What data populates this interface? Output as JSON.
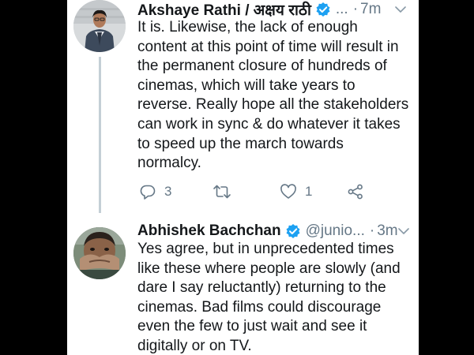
{
  "tweets": [
    {
      "author": {
        "name": "Akshaye Rathi / अक्षय राठी",
        "handle": "",
        "verified": true
      },
      "truncation": "...",
      "separator": "·",
      "time": "7m",
      "text_lines": [
        "It is. Likewise, the lack of enough",
        "content at this point of time will result in",
        "the permanent closure of hundreds of",
        "cinemas, which will take years to",
        "reverse. Really hope all the stakeholders",
        "can work in sync & do whatever it takes",
        "to speed up the march towards",
        "normalcy."
      ],
      "actions": {
        "replies": "3",
        "retweets": "",
        "likes": "1"
      }
    },
    {
      "author": {
        "name": "Abhishek Bachchan",
        "handle": "@junio...",
        "verified": true
      },
      "separator": "·",
      "time": "3m",
      "text_lines": [
        "Yes agree, but in unprecedented times",
        "like these where people are slowly (and",
        "dare I say reluctantly) returning to the",
        "cinemas. Bad films could discourage",
        "even the few to just wait and see it",
        "digitally or on TV."
      ]
    }
  ],
  "icons": {
    "verified": "verified-badge-icon",
    "caret": "chevron-down-icon",
    "reply": "reply-icon",
    "retweet": "retweet-icon",
    "like": "heart-icon",
    "share": "share-icon"
  },
  "colors": {
    "background": "#000000",
    "card": "#ffffff",
    "text": "#14171a",
    "secondary": "#657786",
    "verified": "#1da1f2",
    "thread_line": "#c4cfd6"
  }
}
